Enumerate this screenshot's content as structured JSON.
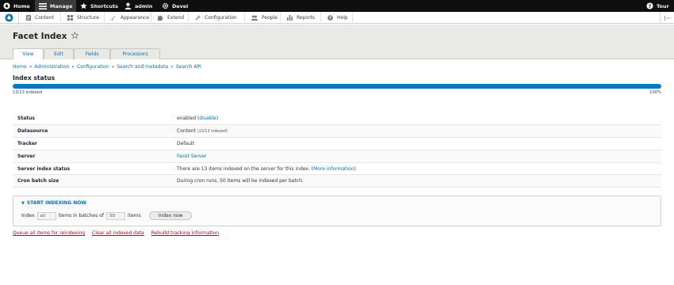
{
  "toolbar": {
    "home": "Home",
    "manage": "Manage",
    "shortcuts": "Shortcuts",
    "user": "admin",
    "devel": "Devel",
    "tour": "Tour"
  },
  "tray": {
    "items": [
      "Content",
      "Structure",
      "Appearance",
      "Extend",
      "Configuration",
      "People",
      "Reports",
      "Help"
    ]
  },
  "page": {
    "title": "Facet Index",
    "tabs": [
      "View",
      "Edit",
      "Fields",
      "Processors"
    ],
    "active_tab": "View"
  },
  "breadcrumb": [
    "Home",
    "Administration",
    "Configuration",
    "Search and metadata",
    "Search API"
  ],
  "breadcrumb_separator": "»",
  "index_status": {
    "heading": "Index status",
    "progress": 1.0,
    "progress_label": "13/13 indexed",
    "progress_percent": "100%"
  },
  "details": {
    "status": {
      "label": "Status",
      "value_prefix": "enabled (",
      "link": "disable",
      "value_suffix": ")"
    },
    "datasource": {
      "label": "Datasource",
      "value": "Content",
      "note": "(13/13 indexed)"
    },
    "tracker": {
      "label": "Tracker",
      "value": "Default"
    },
    "server": {
      "label": "Server",
      "link": "Facet Server"
    },
    "server_index_status": {
      "label": "Server index status",
      "value_prefix": "There are 13 items indexed on the server for this index. (",
      "link": "More information",
      "value_suffix": ")"
    },
    "cron_batch_size": {
      "label": "Cron batch size",
      "value": "During cron runs, 50 items will be indexed per batch."
    }
  },
  "indexing": {
    "legend": "START INDEXING NOW",
    "index_label": "Index",
    "limit_value": "all",
    "batches_label": "items in batches of",
    "batch_value": "50",
    "items_label": "items",
    "button": "Index now"
  },
  "actions": [
    "Queue all items for reindexing",
    "Clear all indexed data",
    "Rebuild tracking information"
  ],
  "colors": {
    "link": "#0074bd",
    "progress": "#0679c2",
    "danger_link": "#d0021b",
    "toolbar_bg": "#0f0f0f"
  }
}
